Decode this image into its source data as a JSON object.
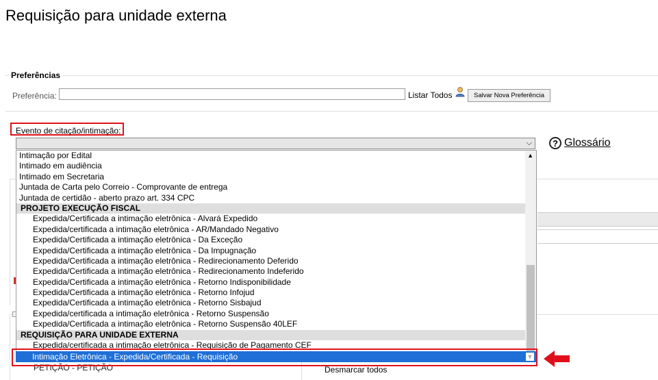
{
  "page": {
    "title": "Requisição para unidade externa"
  },
  "preferences": {
    "legend": "Preferências",
    "label": "Preferência:",
    "input_value": "",
    "listar_todos": "Listar Todos",
    "save_button": "Salvar Nova Preferência"
  },
  "evento": {
    "label": "Evento de citação/intimação:",
    "select_value": ""
  },
  "glossario": {
    "help_icon": "?",
    "label": "Glossário"
  },
  "dropdown": {
    "rows": [
      {
        "type": "option",
        "label": "Intimação por Edital"
      },
      {
        "type": "option",
        "label": "Intimado em audiência"
      },
      {
        "type": "option",
        "label": "Intimado em Secretaria"
      },
      {
        "type": "option",
        "label": "Juntada de Carta pelo Correio - Comprovante de entrega"
      },
      {
        "type": "option",
        "label": "Juntada de certidão - aberto prazo art. 334 CPC"
      },
      {
        "type": "group",
        "label": "PROJETO EXECUÇÃO FISCAL"
      },
      {
        "type": "indent",
        "label": "Expedida/Certificada a intimação eletrônica - Alvará Expedido"
      },
      {
        "type": "indent",
        "label": "Expedida/certificada a intimação eletrônica - AR/Mandado Negativo"
      },
      {
        "type": "indent",
        "label": "Expedida/Certificada a intimação eletrônica - Da Exceção"
      },
      {
        "type": "indent",
        "label": "Expedida/Certificada a intimação eletrônica - Da Impugnação"
      },
      {
        "type": "indent",
        "label": "Expedida/Certificada a intimação eletrônica - Redirecionamento Deferido"
      },
      {
        "type": "indent",
        "label": "Expedida/Certificada a intimação eletrônica - Redirecionamento Indeferido"
      },
      {
        "type": "indent",
        "label": "Expedida/Certificada a intimação eletrônica - Retorno Indisponibilidade"
      },
      {
        "type": "indent",
        "label": "Expedida/Certificada a intimação eletrônica - Retorno Infojud"
      },
      {
        "type": "indent",
        "label": "Expedida/Certificada a intimação eletrônica - Retorno Sisbajud"
      },
      {
        "type": "indent",
        "label": "Expedida/certificada a intimação eletrônica - Retorno Suspensão"
      },
      {
        "type": "indent",
        "label": "Expedida/Certificada a intimação eletrônica - Retorno Suspensão 40LEF"
      },
      {
        "type": "group",
        "label": "REQUISIÇÃO PARA UNIDADE EXTERNA"
      },
      {
        "type": "indent",
        "label": "Expedida/certificada a intimação eletrônica - Requisição de Pagamento CEF"
      }
    ],
    "selected": "Intimação Eletrônica - Expedida/Certificada - Requisição",
    "below_option": "PETIÇÃO - PETIÇÃO"
  },
  "background": {
    "desmarcar": "Desmarcar todos"
  },
  "colors": {
    "highlight_border": "#e0101a",
    "selection": "#1f6fd6",
    "arrow": "#e0101a"
  }
}
